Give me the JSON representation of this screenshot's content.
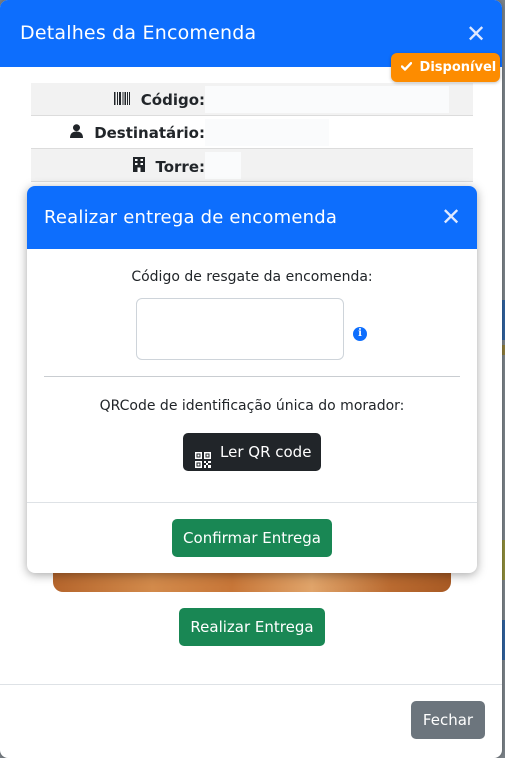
{
  "outer_modal": {
    "title": "Detalhes da Encomenda",
    "close_symbol": "✕",
    "status_badge": {
      "icon": "check-icon",
      "label": "Disponível",
      "color": "#fd8c00"
    },
    "details": [
      {
        "icon": "barcode-icon",
        "label": "Código:",
        "value": ""
      },
      {
        "icon": "user-icon",
        "label": "Destinatário:",
        "value": ""
      },
      {
        "icon": "building-icon",
        "label": "Torre:",
        "value": ""
      }
    ],
    "deliver_button": "Realizar Entrega",
    "close_button": "Fechar"
  },
  "inner_modal": {
    "title": "Realizar entrega de encomenda",
    "close_symbol": "✕",
    "code_label": "Código de resgate da encomenda:",
    "code_input_value": "",
    "info_icon": "i",
    "qr_label": "QRCode de identificação única do morador:",
    "qr_button": "Ler QR code",
    "confirm_button": "Confirmar Entrega"
  },
  "colors": {
    "primary": "#0d6efd",
    "success": "#198754",
    "secondary": "#6c757d",
    "dark": "#212529",
    "warning": "#fd8c00"
  }
}
